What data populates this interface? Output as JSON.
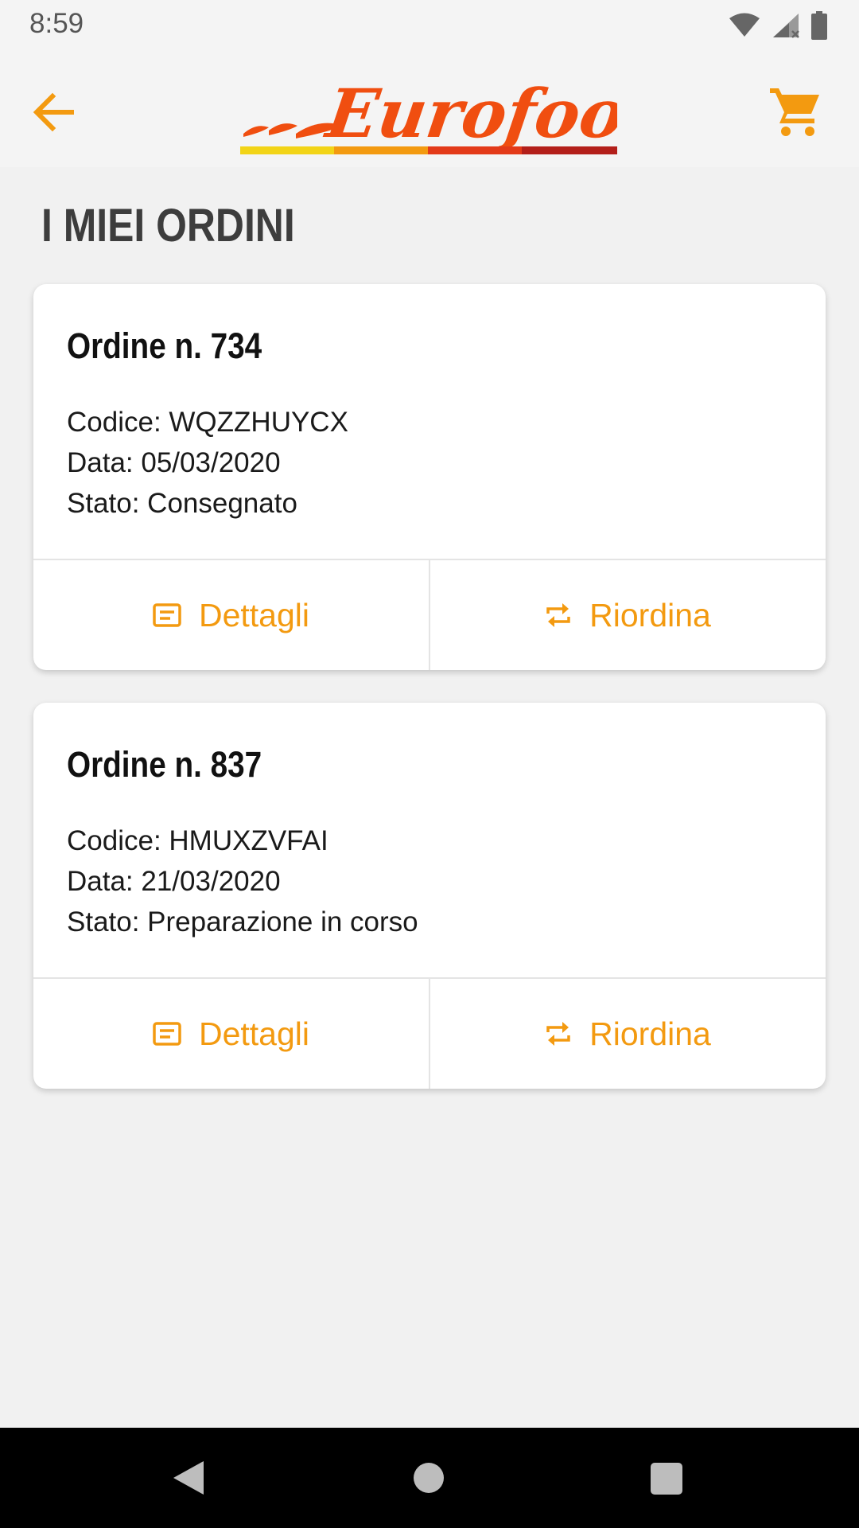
{
  "status_bar": {
    "time": "8:59",
    "icons": [
      "wifi-icon",
      "signal-icon",
      "battery-icon"
    ]
  },
  "header": {
    "logo_text": "Eurofood",
    "logo_stripe_colors": [
      "#f2d417",
      "#f39a10",
      "#e33a19",
      "#b31f1a"
    ],
    "back_icon": "arrow-left-icon",
    "cart_icon": "cart-icon"
  },
  "page": {
    "title": "I MIEI ORDINI"
  },
  "orders": [
    {
      "title": "Ordine n. 734",
      "code": "Codice: WQZZHUYCX",
      "date": "Data: 05/03/2020",
      "status": "Stato: Consegnato",
      "details_label": "Dettagli",
      "reorder_label": "Riordina"
    },
    {
      "title": "Ordine n. 837",
      "code": "Codice: HMUXZVFAI",
      "date": "Data: 21/03/2020",
      "status": "Stato: Preparazione in corso",
      "details_label": "Dettagli",
      "reorder_label": "Riordina"
    }
  ],
  "colors": {
    "accent": "#f39a10",
    "logo_orange": "#f04e10",
    "background": "#f1f1f1"
  }
}
